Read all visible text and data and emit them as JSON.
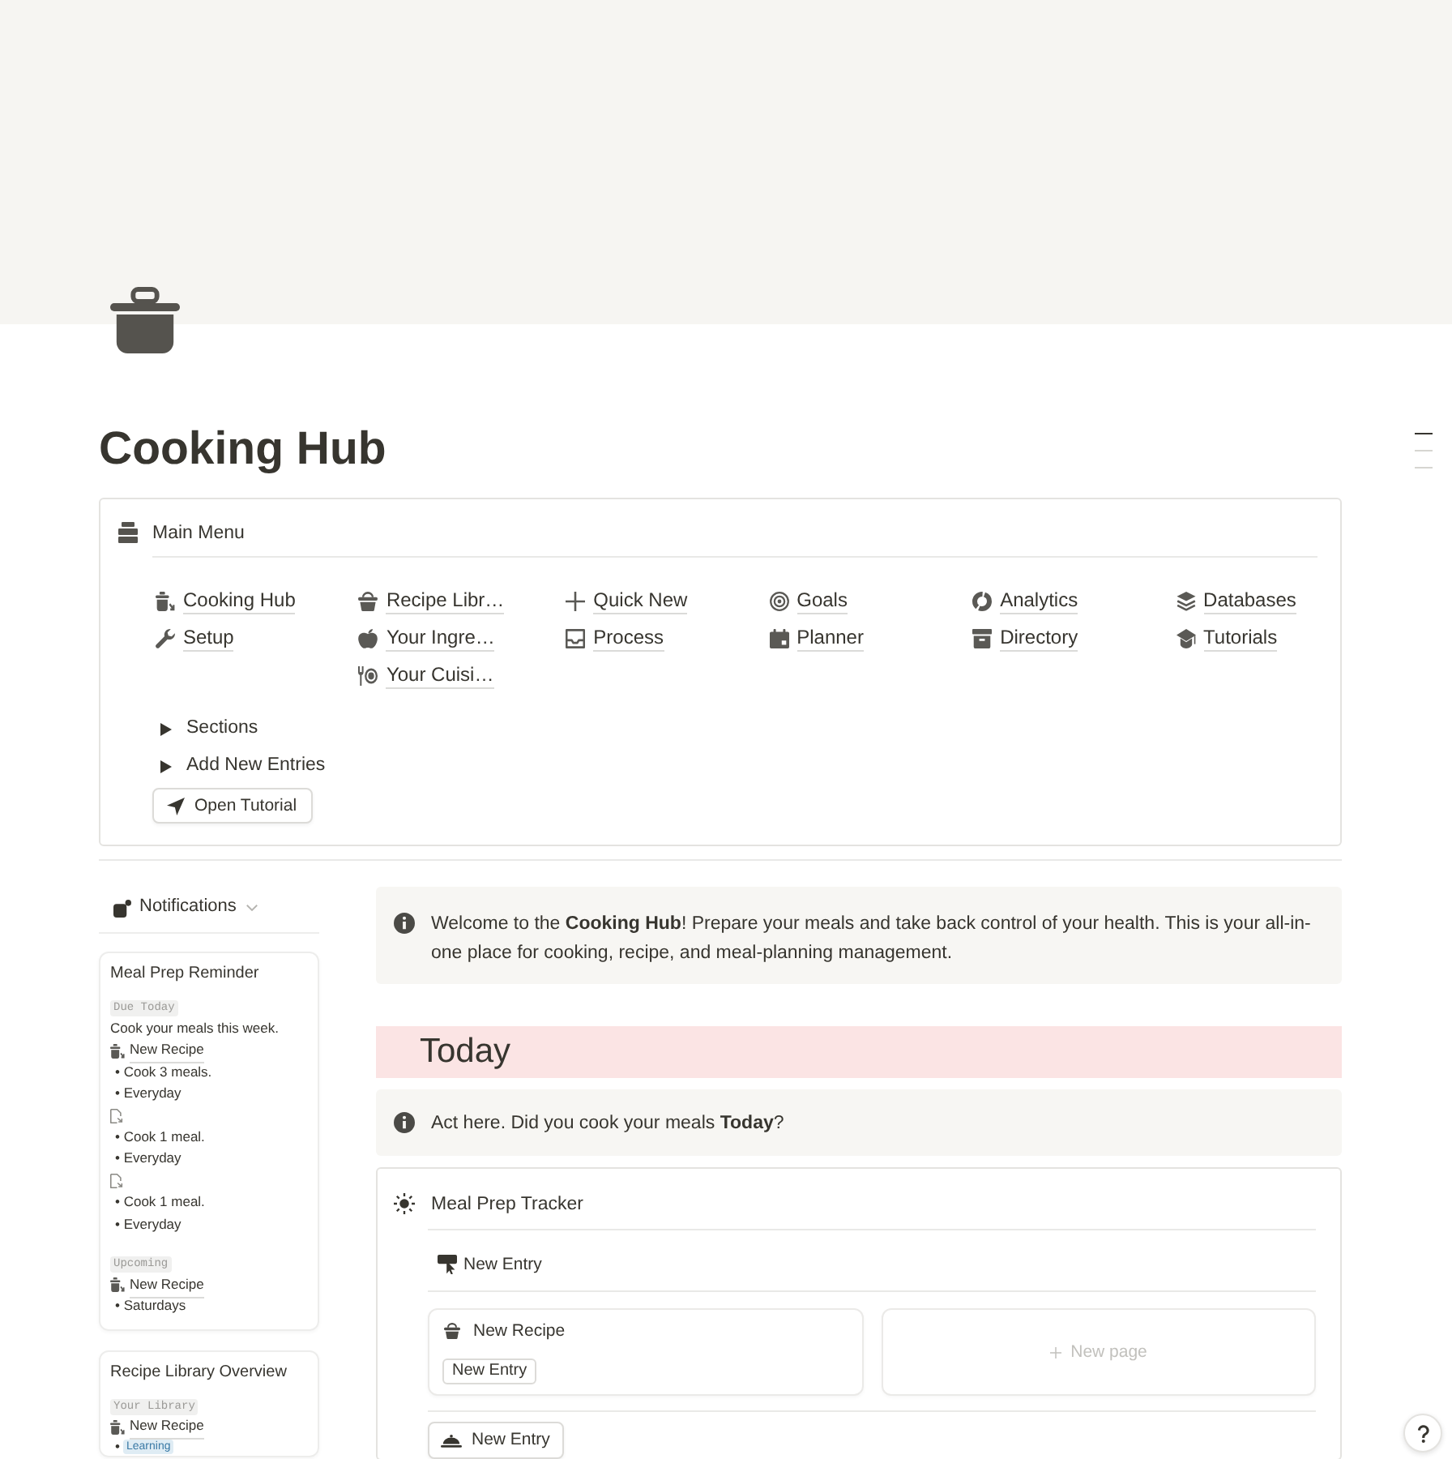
{
  "page": {
    "title": "Cooking Hub"
  },
  "main_menu": {
    "title": "Main Menu",
    "columns": [
      [
        "Cooking Hub",
        "Setup"
      ],
      [
        "Recipe Libr…",
        "Your Ingre…",
        "Your Cuisi…"
      ],
      [
        "Quick New",
        "Process"
      ],
      [
        "Goals",
        "Planner"
      ],
      [
        "Analytics",
        "Directory"
      ],
      [
        "Databases",
        "Tutorials"
      ]
    ],
    "toggles": [
      {
        "label": "Sections",
        "expanded": false
      },
      {
        "label": "Add New Entries",
        "expanded": false
      }
    ],
    "button": "Open Tutorial"
  },
  "notifications": {
    "label": "Notifications",
    "cards": [
      {
        "title": "Meal Prep Reminder",
        "sections": [
          {
            "tag": "Due Today",
            "items": [
              {
                "kind": "text",
                "text": "Cook your meals this week."
              },
              {
                "kind": "link",
                "text": "New Recipe"
              },
              {
                "kind": "bullet",
                "text": "• Cook 3 meals."
              },
              {
                "kind": "bullet",
                "text": "• Everyday"
              },
              {
                "kind": "untitled"
              },
              {
                "kind": "bullet",
                "text": "• Cook 1 meal."
              },
              {
                "kind": "bullet",
                "text": "• Everyday"
              },
              {
                "kind": "untitled"
              },
              {
                "kind": "bullet",
                "text": "• Cook 1 meal."
              },
              {
                "kind": "bullet",
                "text": "• Everyday"
              }
            ]
          },
          {
            "tag": "Upcoming",
            "items": [
              {
                "kind": "link",
                "text": "New Recipe"
              },
              {
                "kind": "bullet",
                "text": "• Saturdays"
              }
            ]
          }
        ]
      },
      {
        "title": "Recipe Library Overview",
        "sections": [
          {
            "tag": "Your Library",
            "items": [
              {
                "kind": "link",
                "text": "New Recipe"
              },
              {
                "kind": "option",
                "bullet": "•",
                "text": "Learning"
              }
            ]
          }
        ]
      }
    ]
  },
  "welcome_callout": {
    "text": "Welcome to the **Cooking Hub**! Prepare your meals and take back control of your health. This is your all-in-one place for cooking, recipe, and meal-planning management."
  },
  "today": {
    "heading": "Today",
    "callout": "Act here. Did you cook your meals **Today**?"
  },
  "meal_prep_tracker": {
    "title": "Meal Prep Tracker",
    "new_entry_link": "New Entry",
    "cards": [
      {
        "title": "New Recipe",
        "tag": "New Entry"
      }
    ],
    "new_page": "New page",
    "button": "New Entry"
  }
}
